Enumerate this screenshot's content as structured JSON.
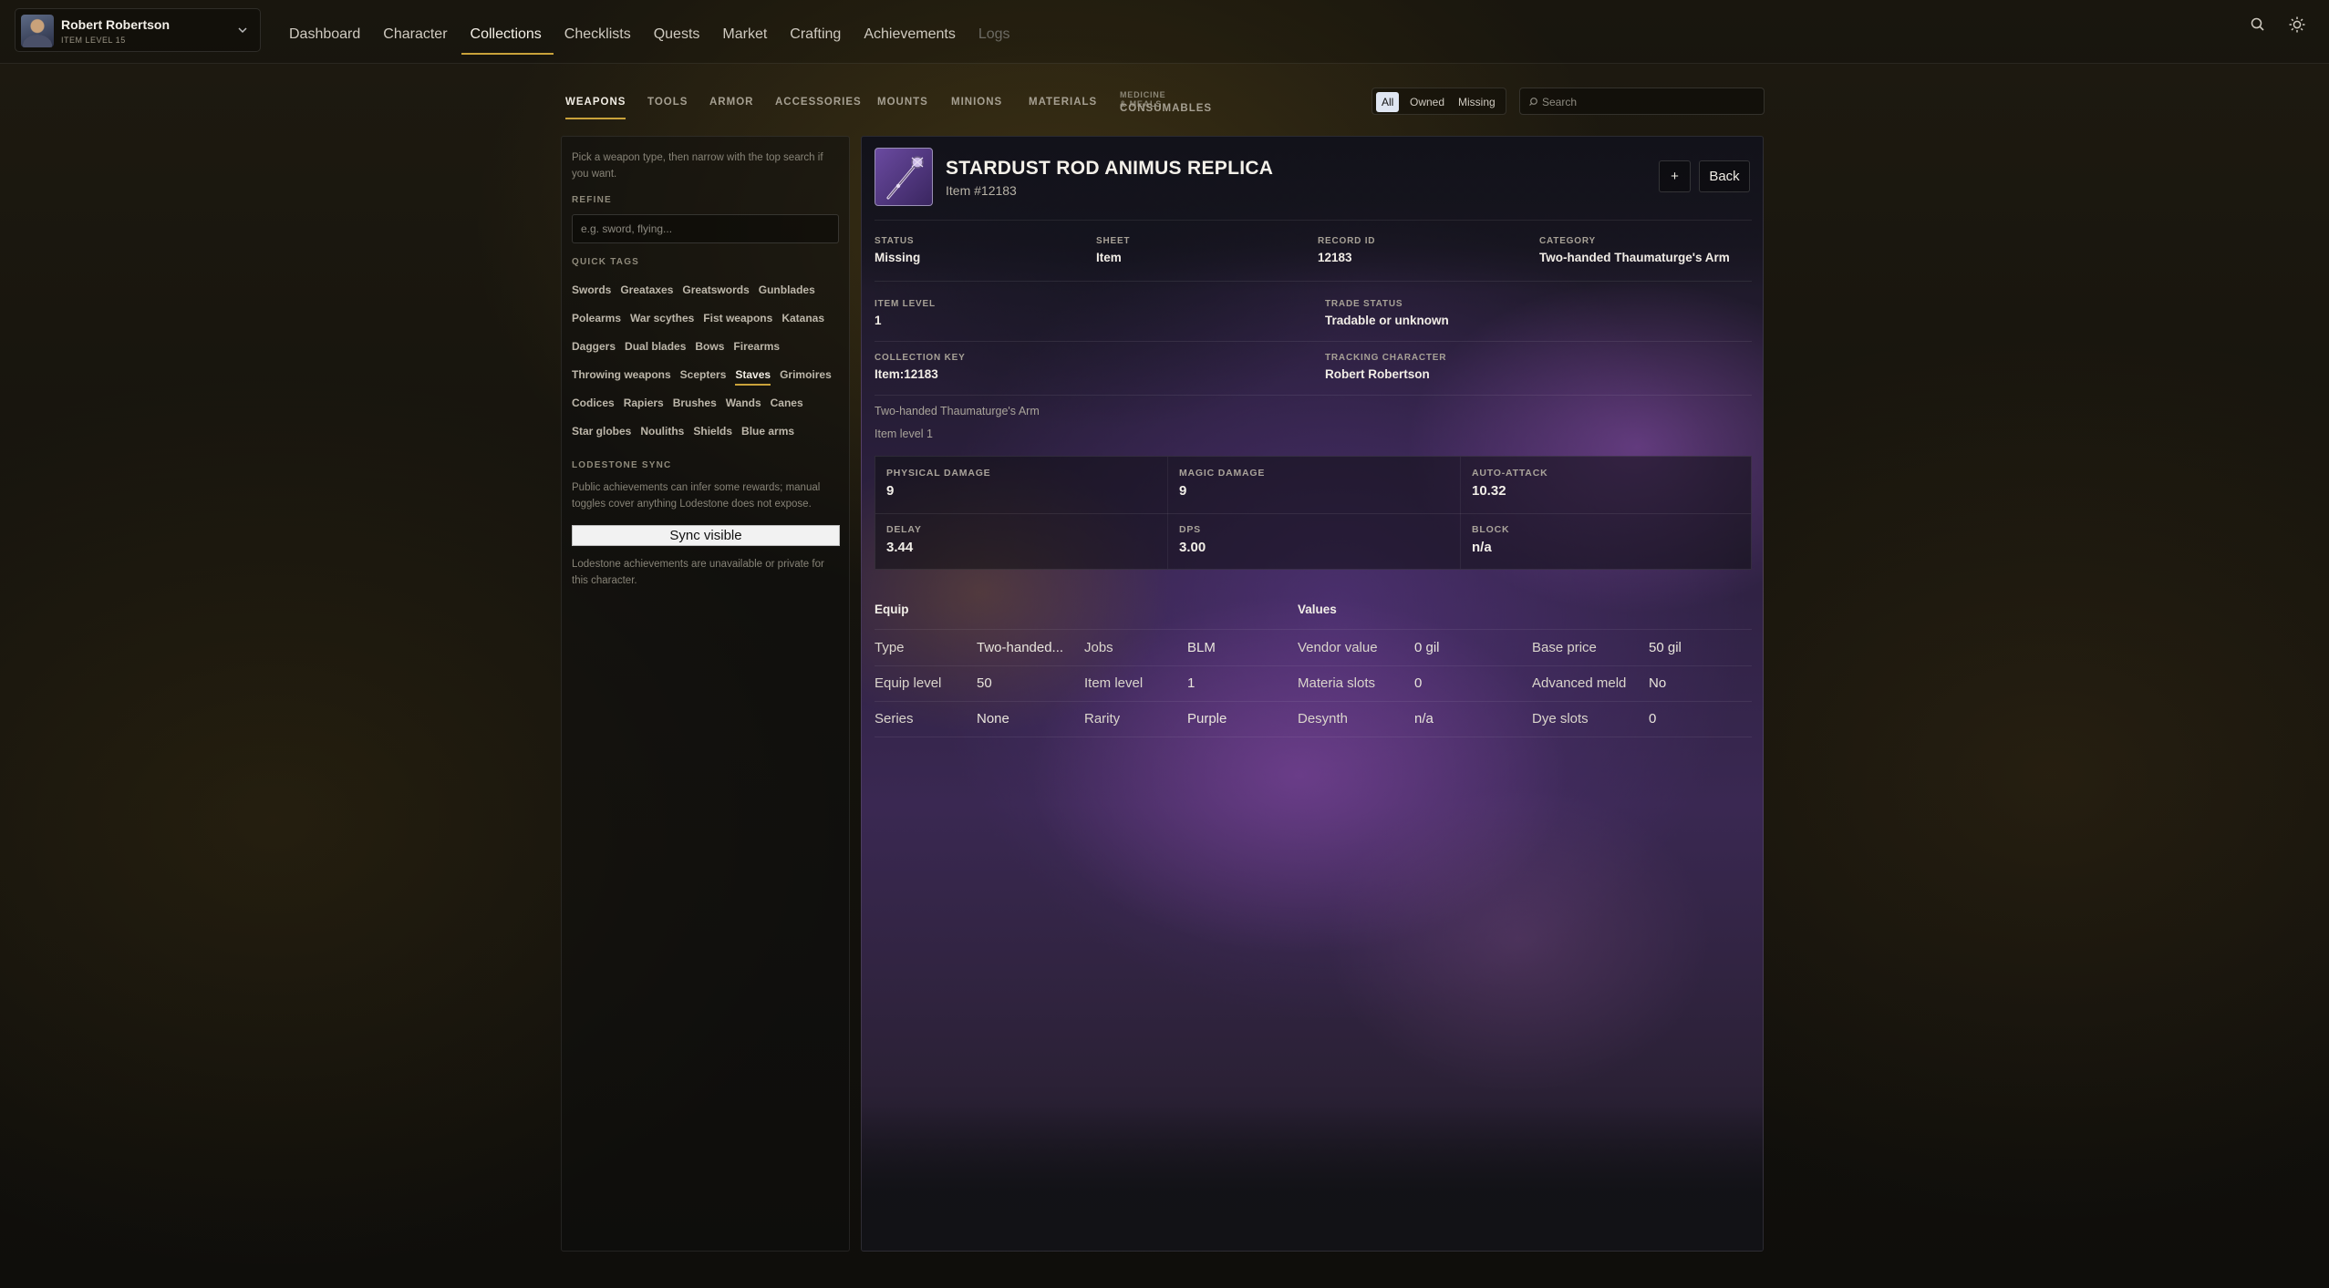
{
  "header": {
    "character": {
      "name": "Robert Robertson",
      "level": "ITEM LEVEL 15"
    },
    "nav": [
      {
        "label": "Dashboard",
        "state": "normal"
      },
      {
        "label": "Character",
        "state": "normal"
      },
      {
        "label": "Collections",
        "state": "active"
      },
      {
        "label": "Checklists",
        "state": "normal"
      },
      {
        "label": "Quests",
        "state": "normal"
      },
      {
        "label": "Market",
        "state": "normal"
      },
      {
        "label": "Crafting",
        "state": "normal"
      },
      {
        "label": "Achievements",
        "state": "normal"
      },
      {
        "label": "Logs",
        "state": "disabled"
      }
    ],
    "icons": {
      "search": "search-icon",
      "settings": "sun-gear-icon",
      "dropdown": "chevron-down-icon"
    }
  },
  "categories": {
    "tabs": [
      "WEAPONS",
      "TOOLS",
      "ARMOR",
      "ACCESSORIES",
      "MOUNTS",
      "MINIONS",
      "MATERIALS",
      "CONSUMABLES"
    ],
    "active": "WEAPONS",
    "consumables_sub": "MEDICINE & MEALS"
  },
  "filter": {
    "options": [
      "All",
      "Owned",
      "Missing"
    ],
    "active": "All"
  },
  "search": {
    "placeholder": "Search",
    "value": ""
  },
  "sidebar": {
    "hint": "Pick a weapon type, then narrow with the top search if you want.",
    "refine_label": "REFINE",
    "refine_placeholder": "e.g. sword, flying...",
    "quick_tags_label": "QUICK TAGS",
    "tag_rows": [
      [
        "Swords",
        "Greataxes",
        "Greatswords",
        "Gunblades"
      ],
      [
        "Polearms",
        "War scythes",
        "Fist weapons",
        "Katanas"
      ],
      [
        "Daggers",
        "Dual blades",
        "Bows",
        "Firearms"
      ],
      [
        "Throwing weapons",
        "Scepters",
        "Staves",
        "Grimoires"
      ],
      [
        "Codices",
        "Rapiers",
        "Brushes",
        "Wands",
        "Canes"
      ],
      [
        "Star globes",
        "Nouliths",
        "Shields",
        "Blue arms"
      ]
    ],
    "active_tag": "Staves",
    "sync_label": "LODESTONE SYNC",
    "sync_note": "Public achievements can infer some rewards; manual toggles cover anything Lodestone does not expose.",
    "sync_button": "Sync visible",
    "sync_status": "Lodestone achievements are unavailable or private for this character."
  },
  "item": {
    "name": "STARDUST ROD ANIMUS REPLICA",
    "number": "Item #12183",
    "plus_label": "+",
    "back_label": "Back",
    "meta": [
      {
        "label": "STATUS",
        "value": "Missing"
      },
      {
        "label": "SHEET",
        "value": "Item"
      },
      {
        "label": "RECORD ID",
        "value": "12183"
      },
      {
        "label": "CATEGORY",
        "value": "Two-handed Thaumaturge's Arm"
      }
    ],
    "meta2": [
      {
        "label": "ITEM LEVEL",
        "value": "1"
      },
      {
        "label": "TRADE STATUS",
        "value": "Tradable or unknown"
      },
      {
        "label": "COLLECTION KEY",
        "value": "Item:12183"
      },
      {
        "label": "TRACKING CHARACTER",
        "value": "Robert Robertson"
      }
    ],
    "subtitle1": "Two-handed Thaumaturge's Arm",
    "subtitle2": "Item level 1",
    "stats": [
      {
        "label": "PHYSICAL DAMAGE",
        "value": "9"
      },
      {
        "label": "MAGIC DAMAGE",
        "value": "9"
      },
      {
        "label": "AUTO-ATTACK",
        "value": "10.32"
      },
      {
        "label": "DELAY",
        "value": "3.44"
      },
      {
        "label": "DPS",
        "value": "3.00"
      },
      {
        "label": "BLOCK",
        "value": "n/a"
      }
    ],
    "equip_heading": "Equip",
    "values_heading": "Values",
    "table": [
      [
        "Type",
        "Two-handed...",
        "Jobs",
        "BLM",
        "Vendor value",
        "0 gil",
        "Base price",
        "50 gil"
      ],
      [
        "Equip level",
        "50",
        "Item level",
        "1",
        "Materia slots",
        "0",
        "Advanced meld",
        "No"
      ],
      [
        "Series",
        "None",
        "Rarity",
        "Purple",
        "Desynth",
        "n/a",
        "Dye slots",
        "0"
      ]
    ]
  }
}
